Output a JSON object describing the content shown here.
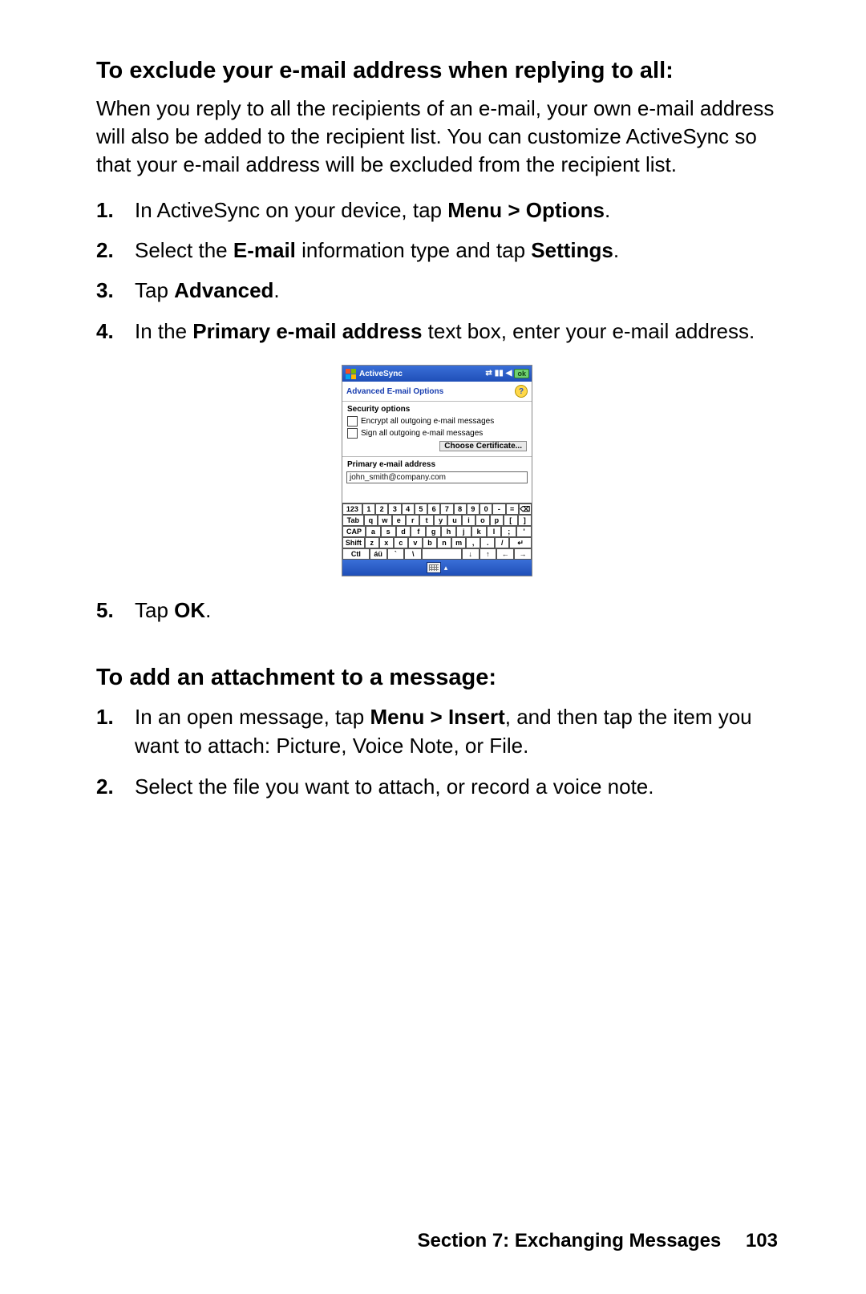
{
  "section1": {
    "heading": "To exclude your e-mail address when replying to all:",
    "intro": "When you reply to all the recipients of an e-mail, your own e-mail address will also be added to the recipient list. You can customize ActiveSync so that your e-mail address will be excluded from the recipient list.",
    "steps": {
      "s1": {
        "num": "1.",
        "a": "In ActiveSync on your device, tap ",
        "b": "Menu > Options",
        "c": "."
      },
      "s2": {
        "num": "2.",
        "a": "Select the ",
        "b": "E-mail",
        "c": " information type and tap ",
        "d": "Settings",
        "e": "."
      },
      "s3": {
        "num": "3.",
        "a": "Tap ",
        "b": "Advanced",
        "c": "."
      },
      "s4": {
        "num": "4.",
        "a": "In the ",
        "b": "Primary e-mail address",
        "c": " text box, enter your e-mail address."
      },
      "s5": {
        "num": "5.",
        "a": "Tap ",
        "b": "OK",
        "c": "."
      }
    }
  },
  "device": {
    "title": "ActiveSync",
    "ok": "ok",
    "subheading": "Advanced E-mail Options",
    "help_char": "?",
    "security_label": "Security options",
    "cb1": "Encrypt all outgoing e-mail messages",
    "cb2": "Sign all outgoing e-mail messages",
    "cert_btn": "Choose Certificate...",
    "primary_label": "Primary e-mail address",
    "email_value": "john_smith@company.com",
    "status": {
      "sync": "⇄",
      "signal": "▮▮",
      "sound": "◀"
    },
    "kbd": {
      "r1": [
        "123",
        "1",
        "2",
        "3",
        "4",
        "5",
        "6",
        "7",
        "8",
        "9",
        "0",
        "-",
        "=",
        "⌫"
      ],
      "r2": [
        "Tab",
        "q",
        "w",
        "e",
        "r",
        "t",
        "y",
        "u",
        "i",
        "o",
        "p",
        "[",
        "]"
      ],
      "r3": [
        "CAP",
        "a",
        "s",
        "d",
        "f",
        "g",
        "h",
        "j",
        "k",
        "l",
        ";",
        "'"
      ],
      "r4": [
        "Shift",
        "z",
        "x",
        "c",
        "v",
        "b",
        "n",
        "m",
        ",",
        ".",
        "/",
        "↵"
      ],
      "r5": [
        "Ctl",
        "áü",
        "`",
        "\\",
        "",
        "↓",
        "↑",
        "←",
        "→"
      ]
    },
    "bottom_arrow": "▴"
  },
  "section2": {
    "heading": "To add an attachment to a message:",
    "steps": {
      "s1": {
        "num": "1.",
        "a": "In an open message, tap ",
        "b": "Menu > Insert",
        "c": ", and then tap the item you want to attach: Picture, Voice Note, or File."
      },
      "s2": {
        "num": "2.",
        "a": "Select the file you want to attach, or record a voice note."
      }
    }
  },
  "footer": {
    "section": "Section 7: Exchanging Messages",
    "page": "103"
  }
}
